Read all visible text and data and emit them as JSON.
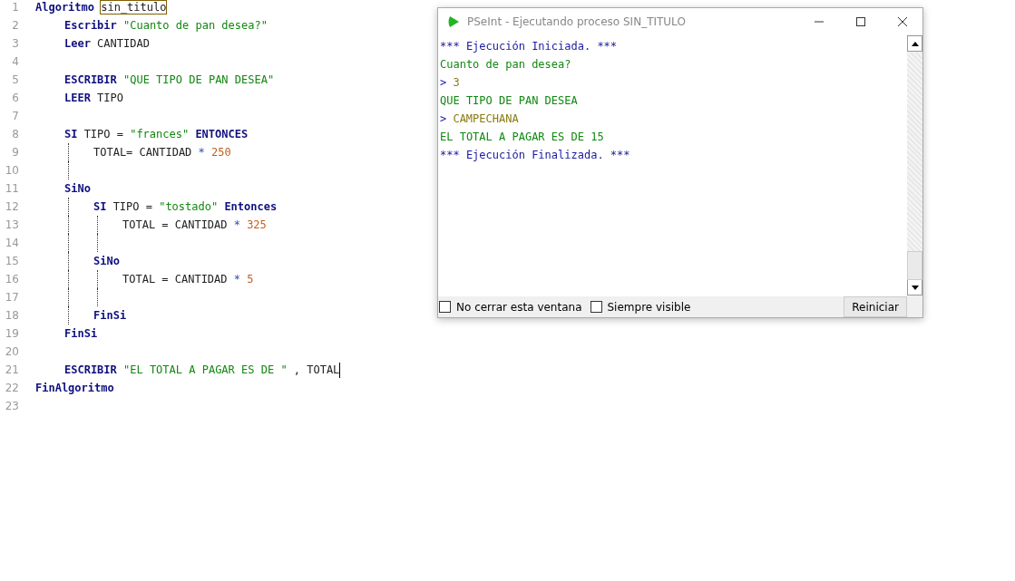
{
  "editor": {
    "lines": [
      {
        "number": "1",
        "tokens": [
          {
            "kind": "kw",
            "text": "Algoritmo"
          },
          {
            "kind": "matched",
            "text": "sin_titulo"
          }
        ],
        "children": [
          {
            "number": "2",
            "tokens": [
              {
                "kind": "kw",
                "text": "Escribir"
              },
              {
                "kind": "str",
                "text": "\"Cuanto de pan desea?\""
              }
            ]
          },
          {
            "number": "3",
            "tokens": [
              {
                "kind": "kw",
                "text": "Leer"
              },
              {
                "kind": "id",
                "text": "CANTIDAD"
              }
            ]
          },
          {
            "number": "4"
          },
          {
            "number": "5",
            "tokens": [
              {
                "kind": "kw",
                "text": "ESCRIBIR"
              },
              {
                "kind": "str",
                "text": "\"QUE TIPO DE PAN DESEA\""
              }
            ]
          },
          {
            "number": "6",
            "tokens": [
              {
                "kind": "kw",
                "text": "LEER"
              },
              {
                "kind": "id",
                "text": "TIPO"
              }
            ]
          },
          {
            "number": "7"
          },
          {
            "number": "8",
            "tokens": [
              {
                "kind": "kw",
                "text": "SI"
              },
              {
                "kind": "id",
                "text": "TIPO"
              },
              {
                "kind": "id",
                "text": "="
              },
              {
                "kind": "str",
                "text": "\"frances\""
              },
              {
                "kind": "kw",
                "text": "ENTONCES"
              }
            ],
            "children": [
              {
                "number": "9",
                "tokens": [
                  {
                    "kind": "id",
                    "text": "TOTAL="
                  },
                  {
                    "kind": "id",
                    "text": "CANTIDAD"
                  },
                  {
                    "kind": "op",
                    "text": "*"
                  },
                  {
                    "kind": "num",
                    "text": "250"
                  }
                ]
              },
              {
                "number": "10"
              }
            ]
          },
          {
            "number": "11",
            "tokens": [
              {
                "kind": "kw",
                "text": "SiNo"
              }
            ],
            "children": [
              {
                "number": "12",
                "tokens": [
                  {
                    "kind": "kw",
                    "text": "SI"
                  },
                  {
                    "kind": "id",
                    "text": "TIPO"
                  },
                  {
                    "kind": "id",
                    "text": "="
                  },
                  {
                    "kind": "str",
                    "text": "\"tostado\""
                  },
                  {
                    "kind": "kw",
                    "text": "Entonces"
                  }
                ],
                "children": [
                  {
                    "number": "13",
                    "tokens": [
                      {
                        "kind": "id",
                        "text": "TOTAL"
                      },
                      {
                        "kind": "id",
                        "text": "="
                      },
                      {
                        "kind": "id",
                        "text": "CANTIDAD"
                      },
                      {
                        "kind": "op",
                        "text": "*"
                      },
                      {
                        "kind": "num",
                        "text": "325"
                      }
                    ]
                  },
                  {
                    "number": "14"
                  }
                ]
              },
              {
                "number": "15",
                "tokens": [
                  {
                    "kind": "kw",
                    "text": "SiNo"
                  }
                ],
                "children": [
                  {
                    "number": "16",
                    "tokens": [
                      {
                        "kind": "id",
                        "text": "TOTAL"
                      },
                      {
                        "kind": "id",
                        "text": "="
                      },
                      {
                        "kind": "id",
                        "text": "CANTIDAD"
                      },
                      {
                        "kind": "op",
                        "text": "*"
                      },
                      {
                        "kind": "num",
                        "text": "5"
                      }
                    ]
                  },
                  {
                    "number": "17"
                  }
                ]
              },
              {
                "number": "18",
                "tokens": [
                  {
                    "kind": "kw",
                    "text": "FinSi"
                  }
                ]
              }
            ]
          },
          {
            "number": "19",
            "tokens": [
              {
                "kind": "kw",
                "text": "FinSi"
              }
            ]
          },
          {
            "number": "20"
          },
          {
            "number": "21",
            "caret": true,
            "tokens": [
              {
                "kind": "kw",
                "text": "ESCRIBIR"
              },
              {
                "kind": "str",
                "text": "\"EL TOTAL A PAGAR ES DE \""
              },
              {
                "kind": "id",
                "text": ","
              },
              {
                "kind": "id",
                "text": "TOTAL"
              }
            ]
          }
        ]
      },
      {
        "number": "22",
        "tokens": [
          {
            "kind": "kw",
            "text": "FinAlgoritmo"
          }
        ]
      },
      {
        "number": "23"
      }
    ]
  },
  "run_window": {
    "title": "PSeInt - Ejecutando proceso SIN_TITULO",
    "console": [
      {
        "kind": "banner",
        "text": "*** Ejecución Iniciada. ***"
      },
      {
        "kind": "output",
        "text": "Cuanto de pan desea?"
      },
      {
        "kind": "input",
        "prompt": ">",
        "text": "3"
      },
      {
        "kind": "output",
        "text": "QUE TIPO DE PAN DESEA"
      },
      {
        "kind": "input",
        "prompt": ">",
        "text": "CAMPECHANA"
      },
      {
        "kind": "output",
        "text": "EL TOTAL A PAGAR ES DE 15"
      },
      {
        "kind": "banner",
        "text": "*** Ejecución Finalizada. ***"
      }
    ],
    "checkboxes": [
      {
        "label": "No cerrar esta ventana",
        "checked": false
      },
      {
        "label": "Siempre visible",
        "checked": false
      }
    ],
    "button": "Reiniciar"
  }
}
